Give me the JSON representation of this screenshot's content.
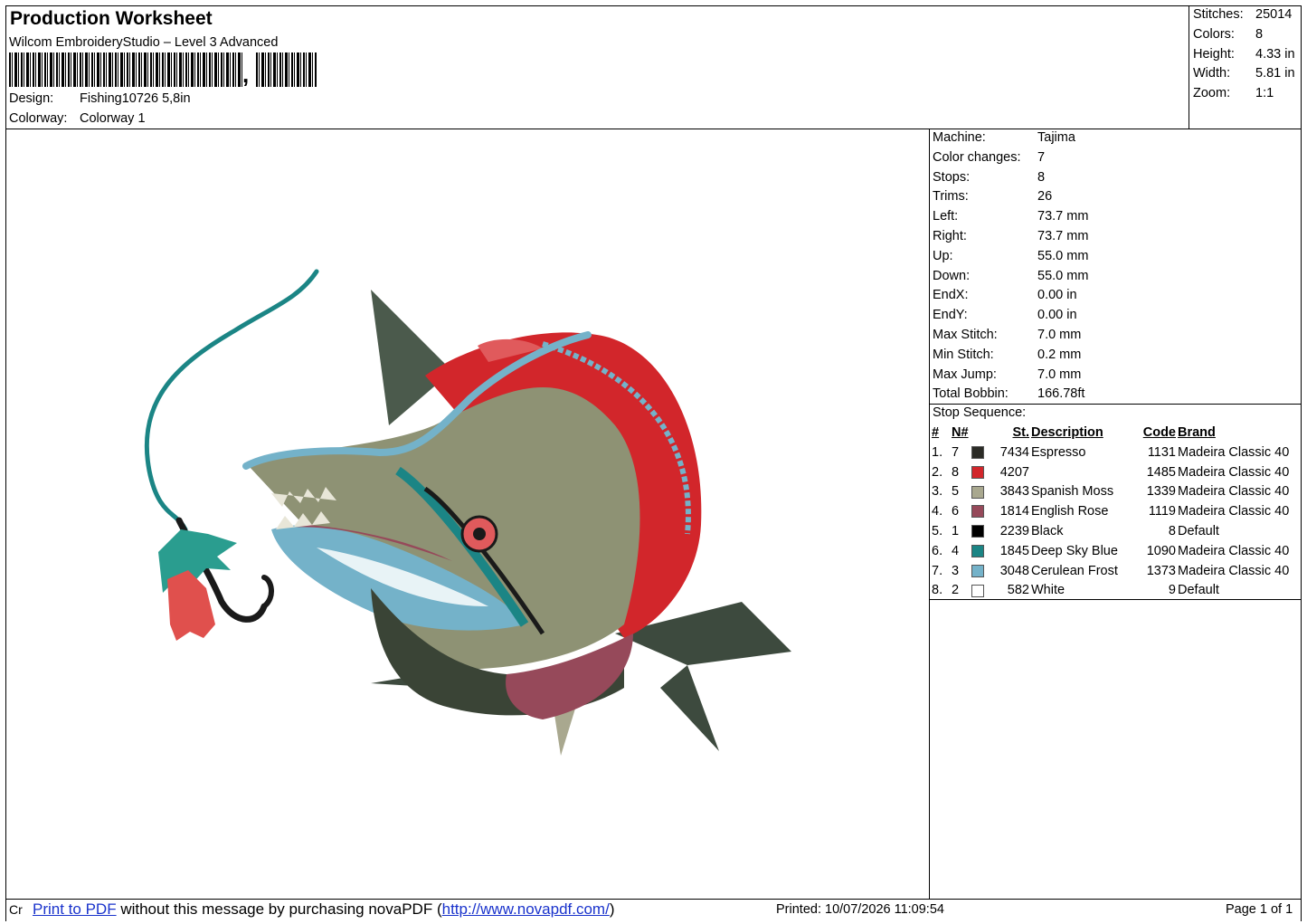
{
  "header": {
    "title": "Production Worksheet",
    "software": "Wilcom EmbroideryStudio – Level 3 Advanced",
    "barcode_suffix": ",",
    "design_label": "Design:",
    "design_value": "Fishing10726 5,8in",
    "colorway_label": "Colorway:",
    "colorway_value": "Colorway 1"
  },
  "summary": [
    {
      "label": "Stitches:",
      "value": "25014"
    },
    {
      "label": "Colors:",
      "value": "8"
    },
    {
      "label": "Height:",
      "value": "4.33 in"
    },
    {
      "label": "Width:",
      "value": "5.81 in"
    },
    {
      "label": "Zoom:",
      "value": "1:1"
    }
  ],
  "machine_info": [
    {
      "label": "Machine:",
      "value": "Tajima"
    },
    {
      "label": "Color changes:",
      "value": "7"
    },
    {
      "label": "Stops:",
      "value": "8"
    },
    {
      "label": "Trims:",
      "value": "26"
    },
    {
      "label": "Left:",
      "value": "73.7 mm"
    },
    {
      "label": "Right:",
      "value": "73.7 mm"
    },
    {
      "label": "Up:",
      "value": "55.0 mm"
    },
    {
      "label": "Down:",
      "value": "55.0 mm"
    },
    {
      "label": "EndX:",
      "value": "0.00 in"
    },
    {
      "label": "EndY:",
      "value": "0.00 in"
    },
    {
      "label": "Max Stitch:",
      "value": "7.0 mm"
    },
    {
      "label": "Min Stitch:",
      "value": "0.2 mm"
    },
    {
      "label": "Max Jump:",
      "value": "7.0 mm"
    },
    {
      "label": "Total Bobbin:",
      "value": "166.78ft"
    }
  ],
  "stop_sequence": {
    "label": "Stop Sequence:",
    "headers": [
      "#",
      "N#",
      "St.",
      "Description",
      "Code",
      "Brand"
    ],
    "rows": [
      {
        "num": "1.",
        "n": "7",
        "color": "#2b2b26",
        "st": "7434",
        "desc": "Espresso",
        "code": "1131",
        "brand": "Madeira Classic 40"
      },
      {
        "num": "2.",
        "n": "8",
        "color": "#d2262b",
        "st": "4207",
        "desc": "",
        "code": "1485",
        "brand": "Madeira Classic 40"
      },
      {
        "num": "3.",
        "n": "5",
        "color": "#a9a88f",
        "st": "3843",
        "desc": "Spanish Moss",
        "code": "1339",
        "brand": "Madeira Classic 40"
      },
      {
        "num": "4.",
        "n": "6",
        "color": "#96495a",
        "st": "1814",
        "desc": "English Rose",
        "code": "1119",
        "brand": "Madeira Classic 40"
      },
      {
        "num": "5.",
        "n": "1",
        "color": "#000000",
        "st": "2239",
        "desc": "Black",
        "code": "8",
        "brand": "Default"
      },
      {
        "num": "6.",
        "n": "4",
        "color": "#1b8585",
        "st": "1845",
        "desc": "Deep Sky Blue",
        "code": "1090",
        "brand": "Madeira Classic 40"
      },
      {
        "num": "7.",
        "n": "3",
        "color": "#74b2c9",
        "st": "3048",
        "desc": "Cerulean Frost",
        "code": "1373",
        "brand": "Madeira Classic 40"
      },
      {
        "num": "8.",
        "n": "2",
        "color": "#ffffff",
        "st": "582",
        "desc": "White",
        "code": "9",
        "brand": "Default"
      }
    ]
  },
  "footer": {
    "cr": "Cr",
    "print_link": "Print to PDF",
    "message": " without this message by purchasing novaPDF (",
    "url": "http://www.novapdf.com/",
    "close": ")",
    "printed": "Printed:  10/07/2026 11:09:54",
    "page": "Page 1 of 1"
  }
}
